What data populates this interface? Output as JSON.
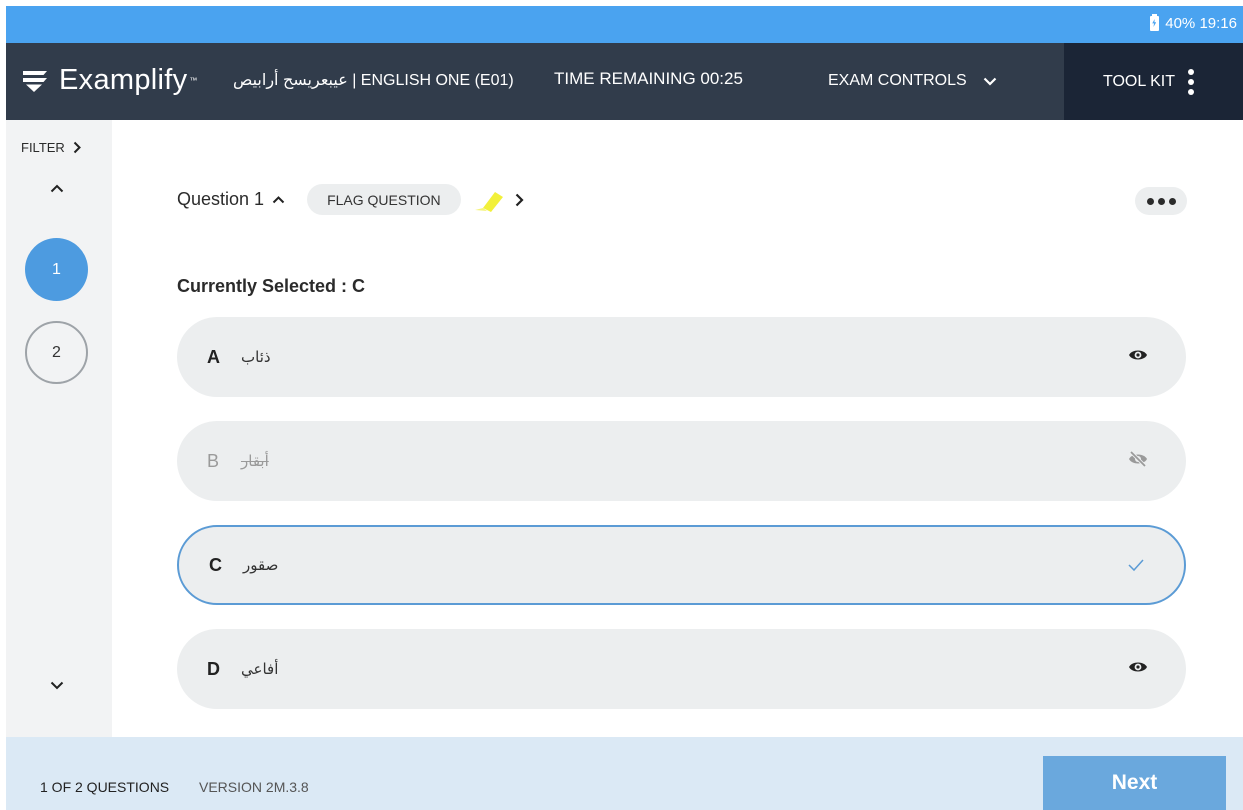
{
  "status_bar": {
    "battery": "40%",
    "time": "19:16",
    "icon": "battery-charging-icon"
  },
  "header": {
    "logo_text": "Examplify",
    "logo_tm": "™",
    "exam_title": "عيبعريسح أرابيص | ENGLISH ONE (E01)",
    "time_remaining": "TIME REMAINING 00:25",
    "exam_controls_label": "EXAM CONTROLS",
    "toolkit_label": "TOOL KIT"
  },
  "sidebar": {
    "filter_label": "FILTER",
    "questions": [
      {
        "number": "1",
        "active": true
      },
      {
        "number": "2",
        "active": false
      }
    ]
  },
  "question": {
    "title": "Question 1",
    "flag_label": "FLAG QUESTION",
    "currently_selected": "Currently Selected : C",
    "options": [
      {
        "letter": "A",
        "text": "ذئاب",
        "state": "normal",
        "icon": "eye-icon"
      },
      {
        "letter": "B",
        "text": "أبقار",
        "state": "struck",
        "icon": "eye-off-icon"
      },
      {
        "letter": "C",
        "text": "صقور",
        "state": "selected",
        "icon": "check-icon"
      },
      {
        "letter": "D",
        "text": "أفاعي",
        "state": "normal",
        "icon": "eye-icon"
      }
    ]
  },
  "footer": {
    "count": "1 OF 2 QUESTIONS",
    "version": "VERSION 2M.3.8",
    "next_label": "Next"
  },
  "colors": {
    "status_bar": "#4aa3f0",
    "header": "#313c4b",
    "toolkit": "#1b2536",
    "accent": "#4d9be0",
    "footer": "#dbe9f5",
    "next_button": "#6aa8dd"
  }
}
